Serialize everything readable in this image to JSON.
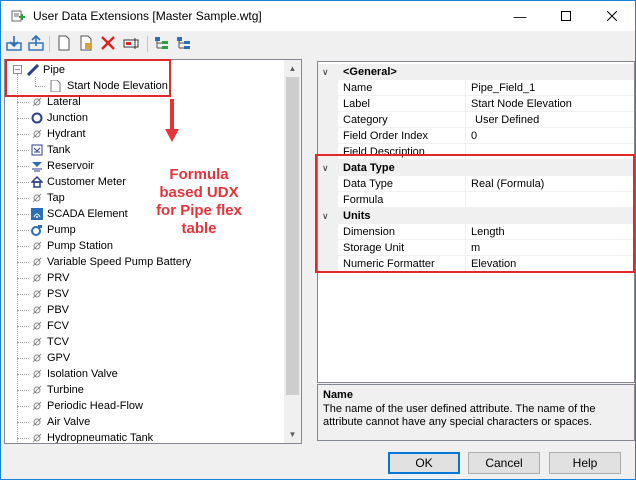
{
  "window": {
    "title": "User Data Extensions [Master Sample.wtg]",
    "controls": [
      "minimize",
      "maximize",
      "close"
    ]
  },
  "toolbar": {
    "icons": [
      "import-icon",
      "export-icon",
      "new-icon",
      "open-icon",
      "delete-icon",
      "rename-icon",
      "expand-all-icon",
      "collapse-all-icon"
    ]
  },
  "tree": {
    "items": [
      {
        "label": "Pipe",
        "icon": "pipe-icon"
      },
      {
        "label": "Start Node Elevation",
        "icon": "field-icon"
      },
      {
        "label": "Lateral",
        "icon": "lateral-icon"
      },
      {
        "label": "Junction",
        "icon": "junction-icon"
      },
      {
        "label": "Hydrant",
        "icon": "hydrant-icon"
      },
      {
        "label": "Tank",
        "icon": "tank-icon"
      },
      {
        "label": "Reservoir",
        "icon": "reservoir-icon"
      },
      {
        "label": "Customer Meter",
        "icon": "customer-meter-icon"
      },
      {
        "label": "Tap",
        "icon": "tap-icon"
      },
      {
        "label": "SCADA Element",
        "icon": "scada-icon"
      },
      {
        "label": "Pump",
        "icon": "pump-icon"
      },
      {
        "label": "Pump Station",
        "icon": "pump-station-icon"
      },
      {
        "label": "Variable Speed Pump Battery",
        "icon": "vspb-icon"
      },
      {
        "label": "PRV",
        "icon": "valve-icon"
      },
      {
        "label": "PSV",
        "icon": "valve-icon"
      },
      {
        "label": "PBV",
        "icon": "valve-icon"
      },
      {
        "label": "FCV",
        "icon": "valve-icon"
      },
      {
        "label": "TCV",
        "icon": "valve-icon"
      },
      {
        "label": "GPV",
        "icon": "valve-icon"
      },
      {
        "label": "Isolation Valve",
        "icon": "valve-icon"
      },
      {
        "label": "Turbine",
        "icon": "turbine-icon"
      },
      {
        "label": "Periodic Head-Flow",
        "icon": "head-flow-icon"
      },
      {
        "label": "Air Valve",
        "icon": "air-valve-icon"
      },
      {
        "label": "Hydropneumatic Tank",
        "icon": "hydropneumatic-tank-icon"
      }
    ]
  },
  "annotation": {
    "line1": "Formula",
    "line2": "based UDX",
    "line3": "for Pipe flex",
    "line4": "table"
  },
  "properties": {
    "general": {
      "header": "<General>",
      "rows": [
        {
          "name": "Name",
          "value": "Pipe_Field_1"
        },
        {
          "name": "Label",
          "value": "Start Node Elevation"
        },
        {
          "name": "Category",
          "value": "User Defined"
        },
        {
          "name": "Field Order Index",
          "value": "0"
        },
        {
          "name": "Field Description",
          "value": ""
        }
      ]
    },
    "data_type": {
      "header": "Data Type",
      "rows": [
        {
          "name": "Data Type",
          "value": "Real (Formula)"
        },
        {
          "name": "Formula",
          "value": ""
        }
      ]
    },
    "units": {
      "header": "Units",
      "rows": [
        {
          "name": "Dimension",
          "value": "Length"
        },
        {
          "name": "Storage Unit",
          "value": "m"
        },
        {
          "name": "Numeric Formatter",
          "value": "Elevation"
        }
      ]
    }
  },
  "description": {
    "title": "Name",
    "text": "The name of the user defined attribute.  The name of the attribute cannot have any special characters or spaces."
  },
  "buttons": {
    "ok": "OK",
    "cancel": "Cancel",
    "help": "Help"
  },
  "colors": {
    "annotation_red": "#e02a2a",
    "accent_blue": "#1883d7"
  }
}
